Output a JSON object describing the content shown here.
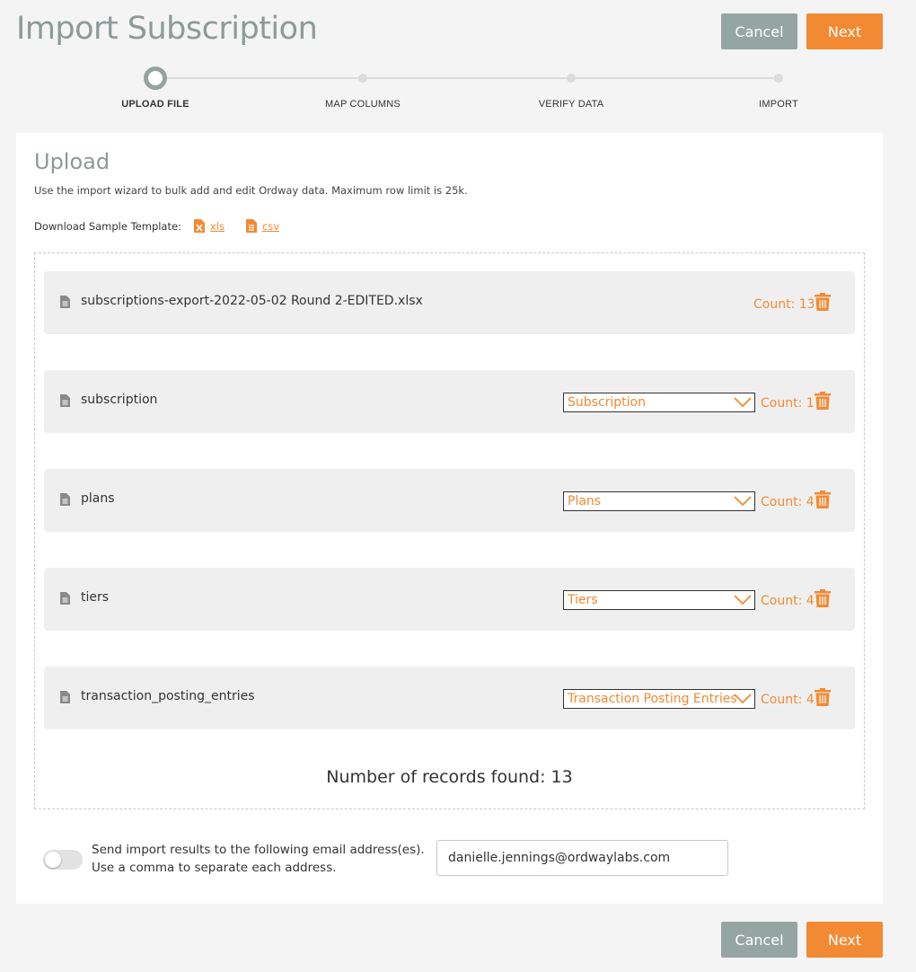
{
  "header": {
    "title": "Import Subscription",
    "cancel_label": "Cancel",
    "next_label": "Next"
  },
  "stepper": {
    "steps": [
      {
        "label": "UPLOAD FILE",
        "active": true
      },
      {
        "label": "MAP COLUMNS",
        "active": false
      },
      {
        "label": "VERIFY DATA",
        "active": false
      },
      {
        "label": "IMPORT",
        "active": false
      }
    ]
  },
  "upload": {
    "title": "Upload",
    "description": "Use the import wizard to bulk add and edit Ordway data. Maximum row limit is 25k.",
    "download_label": "Download Sample Template:",
    "xls_label": "xls",
    "csv_label": "csv"
  },
  "files": [
    {
      "name": "subscriptions-export-2022-05-02 Round 2-EDITED.xlsx",
      "select": "",
      "count": "Count: 13"
    },
    {
      "name": "subscription",
      "select": "Subscription",
      "count": "Count: 1"
    },
    {
      "name": "plans",
      "select": "Plans",
      "count": "Count: 4"
    },
    {
      "name": "tiers",
      "select": "Tiers",
      "count": "Count: 4"
    },
    {
      "name": "transaction_posting_entries",
      "select": "Transaction Posting Entries",
      "count": "Count: 4"
    }
  ],
  "records_found": "Number of records found: 13",
  "email": {
    "label_line1": "Send import results to the following email address(es).",
    "label_line2": "Use a comma to separate each address.",
    "value": "danielle.jennings@ordwaylabs.com",
    "toggle_on": false
  },
  "footer": {
    "cancel_label": "Cancel",
    "next_label": "Next"
  },
  "colors": {
    "accent": "#f28a33",
    "secondary": "#95a5a2",
    "title": "#8d9a98"
  }
}
